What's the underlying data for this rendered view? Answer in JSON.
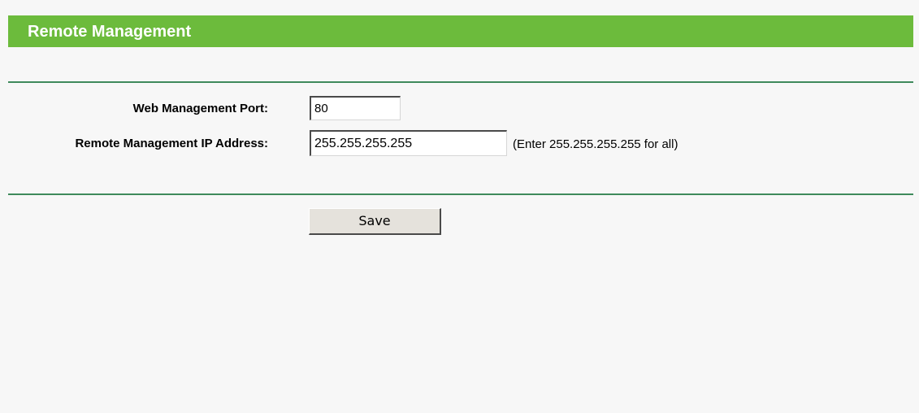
{
  "header": {
    "title": "Remote Management"
  },
  "form": {
    "port": {
      "label": "Web Management Port:",
      "value": "80"
    },
    "ip": {
      "label": "Remote Management IP Address:",
      "value": "255.255.255.255",
      "hint": "(Enter 255.255.255.255 for all)"
    },
    "save_label": "Save"
  },
  "colors": {
    "header_bg": "#6cbb3c",
    "divider": "#3f8a5c",
    "page_bg": "#f7f7f7"
  }
}
